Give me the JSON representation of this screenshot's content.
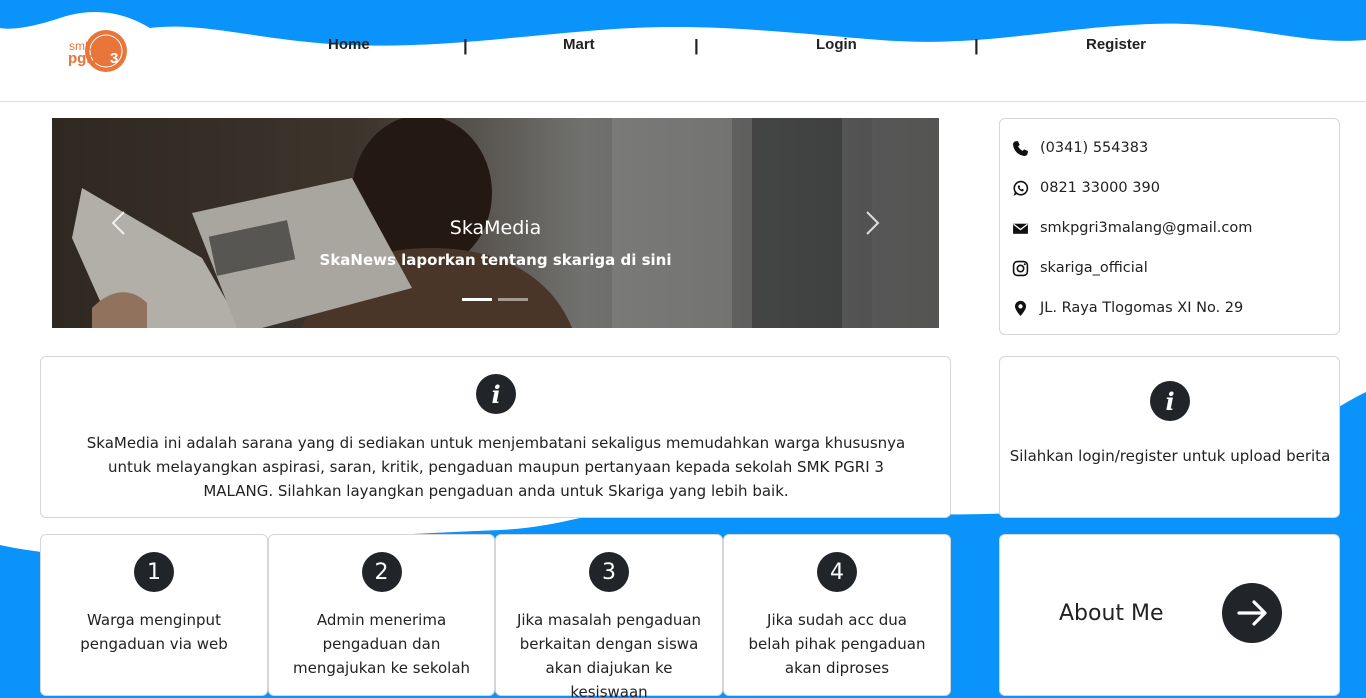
{
  "colors": {
    "accent_blue": "#0b93fc",
    "dark": "#212529"
  },
  "header": {
    "logo_text": "smk pgri 3",
    "nav": [
      {
        "label": "Home"
      },
      {
        "label": "Mart"
      },
      {
        "label": "Login"
      },
      {
        "label": "Register"
      }
    ],
    "separator": "|"
  },
  "carousel": {
    "title": "SkaMedia",
    "caption": "SkaNews laporkan tentang skariga di sini",
    "prev_icon": "chevron-left-icon",
    "next_icon": "chevron-right-icon",
    "slide_count": 2,
    "active_slide": 1
  },
  "contact": {
    "items": [
      {
        "icon": "phone-icon",
        "text": "(0341) 554383"
      },
      {
        "icon": "whatsapp-icon",
        "text": "0821 33000 390"
      },
      {
        "icon": "envelope-icon",
        "text": "smkpgri3malang@gmail.com"
      },
      {
        "icon": "instagram-icon",
        "text": "skariga_official"
      },
      {
        "icon": "location-pin-icon",
        "text": "JL. Raya Tlogomas XI No. 29"
      }
    ]
  },
  "info": {
    "icon_glyph": "i",
    "text": "SkaMedia ini adalah sarana yang di sediakan untuk menjembatani sekaligus memudahkan warga khususnya untuk melayangkan aspirasi, saran, kritik, pengaduan maupun pertanyaan kepada sekolah SMK PGRI 3 MALANG. Silahkan layangkan pengaduan anda untuk Skariga yang lebih baik."
  },
  "login_notice": {
    "icon_glyph": "i",
    "text": "Silahkan login/register untuk upload berita"
  },
  "steps": [
    {
      "number": "1",
      "text": "Warga menginput pengaduan via web"
    },
    {
      "number": "2",
      "text": "Admin menerima pengaduan dan mengajukan ke sekolah"
    },
    {
      "number": "3",
      "text": "Jika masalah pengaduan berkaitan dengan siswa akan diajukan ke kesiswaan"
    },
    {
      "number": "4",
      "text": "Jika sudah acc dua belah pihak pengaduan akan diproses"
    }
  ],
  "about": {
    "label": "About Me",
    "icon": "arrow-right-icon"
  }
}
